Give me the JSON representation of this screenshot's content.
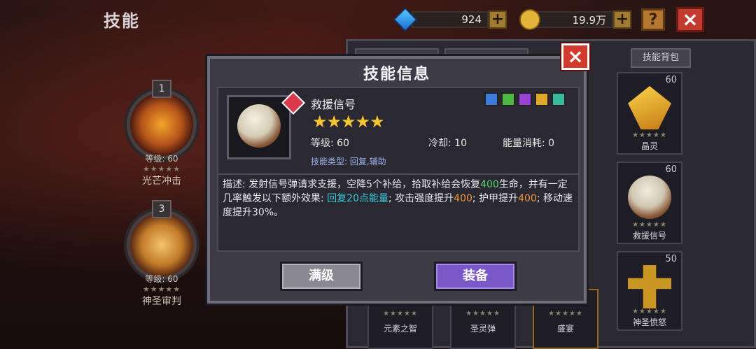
{
  "header": {
    "title": "技能"
  },
  "resources": {
    "gems": "924",
    "gold": "19.9万",
    "plus": "+"
  },
  "top_buttons": {
    "help": "?",
    "close": "×"
  },
  "left_skills": [
    {
      "number": "1",
      "level": "等级: 60",
      "stars": "★★★★★",
      "name": "光芒冲击"
    },
    {
      "number": "3",
      "level": "等级: 60",
      "stars": "★★★★★",
      "name": "神圣审判"
    }
  ],
  "right_panel": {
    "bag_button": "技能背包",
    "cards": [
      {
        "level": "60",
        "stars": "★★★★★",
        "name": "晶灵"
      },
      {
        "level": "60",
        "stars": "★★★★★",
        "name": "救援信号"
      },
      {
        "level": "50",
        "stars": "★★★★★",
        "name": "神圣愤怒"
      }
    ],
    "bottom_cards": [
      {
        "stars": "★★★★★",
        "name": "元素之智"
      },
      {
        "stars": "★★★★★",
        "name": "圣灵弹"
      },
      {
        "stars": "★★★★★",
        "name": "盛宴"
      }
    ]
  },
  "dialog": {
    "title": "技能信息",
    "close": "×",
    "skill_name": "救援信号",
    "stars": "★★★★★",
    "level": "等级: 60",
    "cooldown": "冷却: 10",
    "energy": "能量消耗: 0",
    "type": "技能类型: 回复,辅助",
    "desc_1": "描述: 发射信号弹请求支援，空降5个补给，拾取补给会恢复",
    "desc_hl_1": "400",
    "desc_2": "生命，并有一定几率触发以下额外效果: ",
    "desc_hl_2": "回复20点能量",
    "desc_3": "; 攻击强度提升",
    "desc_hl_3": "400",
    "desc_4": "; 护甲提升",
    "desc_hl_4": "400",
    "desc_5": "; 移动速度提升30%。",
    "btn_max": "满级",
    "btn_equip": "装备",
    "tag_colors": [
      "#3d7bdc",
      "#4eb847",
      "#9a43d6",
      "#e0a82a",
      "#3bb8a0"
    ]
  }
}
